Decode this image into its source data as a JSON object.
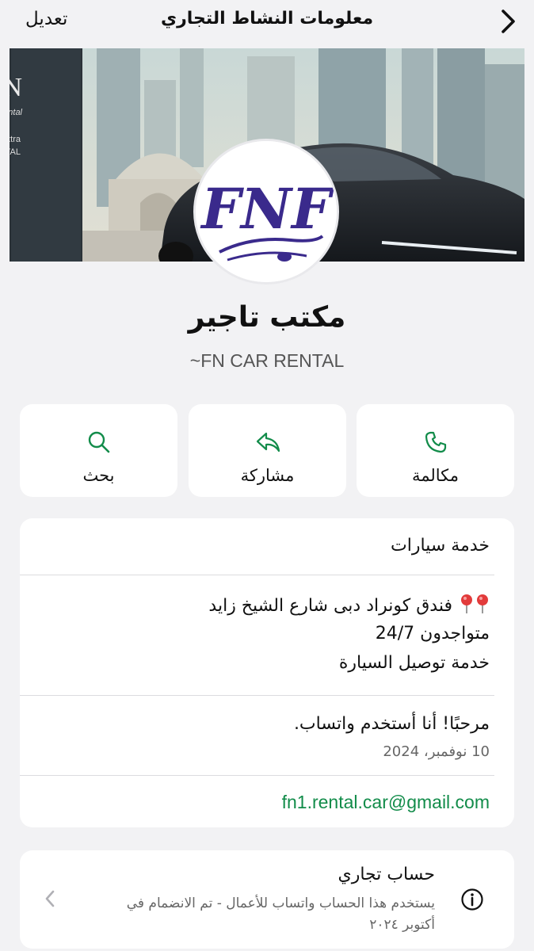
{
  "topbar": {
    "title": "معلومات النشاط التجاري",
    "edit_label": "تعديل"
  },
  "cover": {
    "sign_line1": "FN",
    "sign_line2": "Car Rental",
    "sign_line3": "CAR Extra",
    "sign_line4": "RENTAL"
  },
  "profile": {
    "logo_text": "FNF",
    "business_name": "مكتب تاجير",
    "push_name": "~FN CAR RENTAL"
  },
  "actions": {
    "call_label": "مكالمة",
    "share_label": "مشاركة",
    "search_label": "بحث"
  },
  "info": {
    "category": "خدمة سيارات",
    "description_line1": "فندق كونراد دبى شارع الشيخ زايد",
    "description_line2": "متواجدون 24/7",
    "description_line3": "خدمة توصيل السيارة",
    "about": "مرحبًا! أنا أستخدم واتساب.",
    "about_date": "10 نوفمبر، 2024",
    "email": "fn1.rental.car@gmail.com"
  },
  "account": {
    "title": "حساب تجاري",
    "subtitle_line1": "يستخدم هذا الحساب واتساب للأعمال - تم الانضمام في",
    "subtitle_line2": "أكتوبر ٢٠٢٤"
  },
  "colors": {
    "accent_green": "#128c4a",
    "background": "#f2f2f4",
    "logo_purple": "#3a2a8c"
  },
  "icons": {
    "back": "chevron-left-icon",
    "call": "phone-icon",
    "share": "share-arrow-icon",
    "search": "search-icon",
    "pin": "pin-icon",
    "info": "info-icon",
    "chevron": "chevron-right-icon"
  }
}
